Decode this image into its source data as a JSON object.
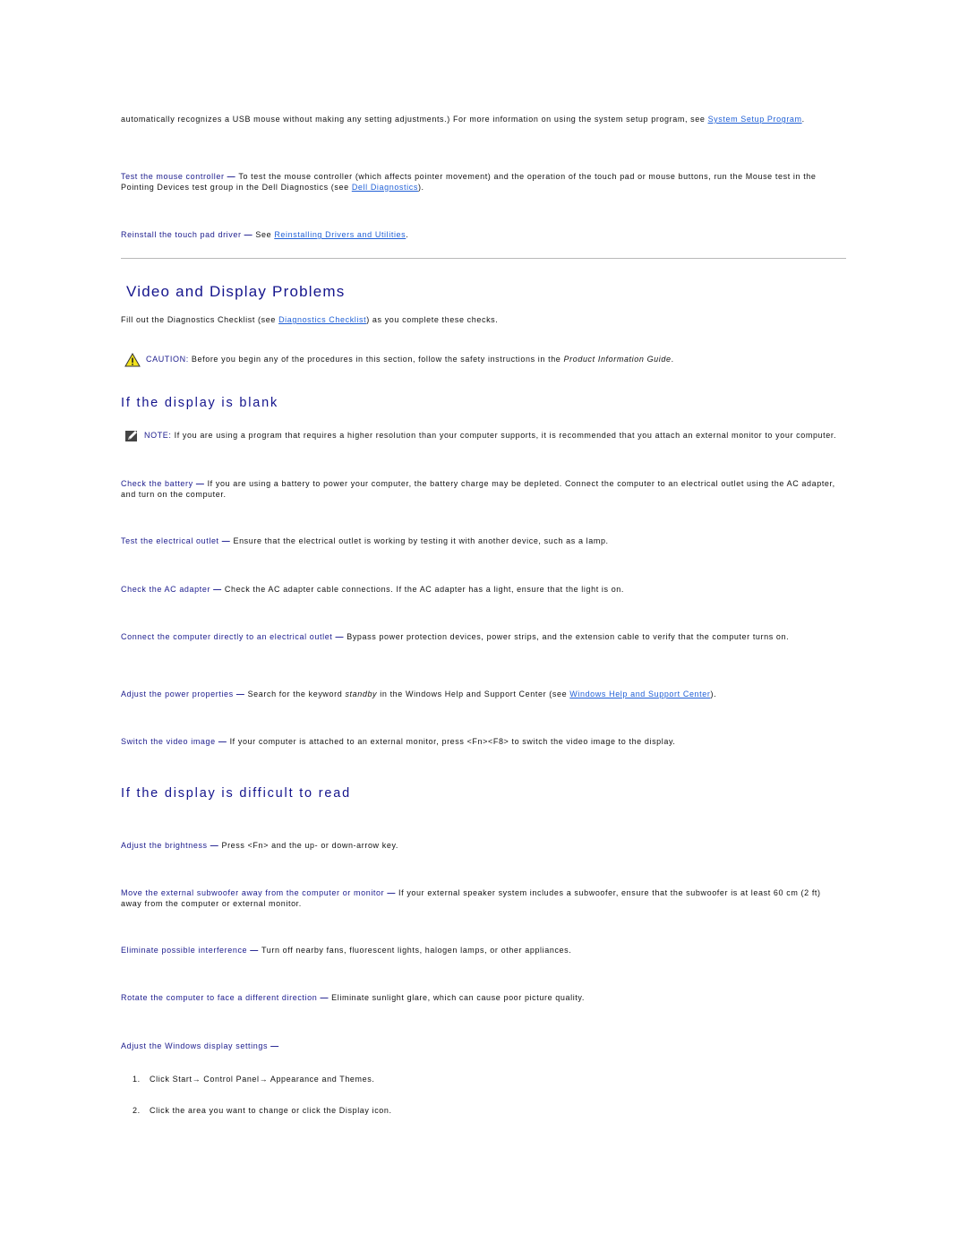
{
  "intro": {
    "text": "automatically recognizes a USB mouse without making any setting adjustments.) For more information on using the system setup program, see ",
    "link": "System Setup Program",
    "end": "."
  },
  "mouse_items": [
    {
      "term": "Test the mouse controller",
      "dash": " — ",
      "text": "To test the mouse controller (which affects pointer movement) and the operation of the touch pad or mouse buttons, run the Mouse test in the Pointing Devices test group in the Dell Diagnostics (see ",
      "link": "Dell Diagnostics",
      "end": ")."
    },
    {
      "term": "Reinstall the touch pad driver",
      "dash": " — ",
      "text": "See ",
      "link": "Reinstalling Drivers and Utilities",
      "end": "."
    }
  ],
  "section": {
    "title": "Video and Display Problems",
    "intro_text": "Fill out the Diagnostics Checklist (see ",
    "intro_link": "Diagnostics Checklist",
    "intro_end": ") as you complete these checks.",
    "caution": {
      "icon": "warning-triangle-icon",
      "label": "CAUTION:",
      "text": " Before you begin any of the procedures in this section, follow the safety instructions in the ",
      "italic": "Product Information Guide",
      "end": "."
    }
  },
  "blank": {
    "heading": "If the display is blank",
    "note": {
      "icon": "pencil-note-icon",
      "label": "NOTE:",
      "text": " If you are using a program that requires a higher resolution than your computer supports, it is recommended that you attach an external monitor to your computer."
    },
    "items": [
      {
        "term": "Check the battery",
        "dash": " — ",
        "text": "If you are using a battery to power your computer, the battery charge may be depleted. Connect the computer to an electrical outlet using the AC adapter, and turn on the computer."
      },
      {
        "term": "Test the electrical outlet",
        "dash": " — ",
        "text": "Ensure that the electrical outlet is working by testing it with another device, such as a lamp."
      },
      {
        "term": "Check the AC adapter",
        "dash": " — ",
        "text": "Check the AC adapter cable connections. If the AC adapter has a light, ensure that the light is on."
      },
      {
        "term": "Connect the computer directly to an electrical outlet",
        "dash": " — ",
        "text": "Bypass power protection devices, power strips, and the extension cable to verify that the computer turns on."
      },
      {
        "term": "Adjust the power properties",
        "dash": " — ",
        "text": "Search for the keyword ",
        "italic": "standby",
        "text2": " in the Windows Help and Support Center (see ",
        "link": "Windows Help and Support Center",
        "end": ")."
      },
      {
        "term": "Switch the video image",
        "dash": " — ",
        "text": "If your computer is attached to an external monitor, press <Fn><F8> to switch the video image to the display."
      }
    ]
  },
  "difficult": {
    "heading": "If the display is difficult to read",
    "items": [
      {
        "term": "Adjust the brightness",
        "dash": " — ",
        "text": "Press <Fn> and the up- or down-arrow key."
      },
      {
        "term": "Move the external subwoofer away from the computer or monitor",
        "dash": " — ",
        "text": "If your external speaker system includes a subwoofer, ensure that the subwoofer is at least 60 cm (2 ft) away from the computer or external monitor."
      },
      {
        "term": "Eliminate possible interference",
        "dash": " — ",
        "text": "Turn off nearby fans, fluorescent lights, halogen lamps, or other appliances."
      },
      {
        "term": "Rotate the computer to face a different direction",
        "dash": " — ",
        "text": "Eliminate sunlight glare, which can cause poor picture quality."
      },
      {
        "term": "Adjust the Windows display settings",
        "dash": " —"
      }
    ],
    "steps": [
      {
        "num": "1.",
        "text": "Click Start→ Control Panel→ Appearance and Themes."
      },
      {
        "num": "2.",
        "text": "Click the area you want to change or click the Display icon."
      }
    ]
  }
}
